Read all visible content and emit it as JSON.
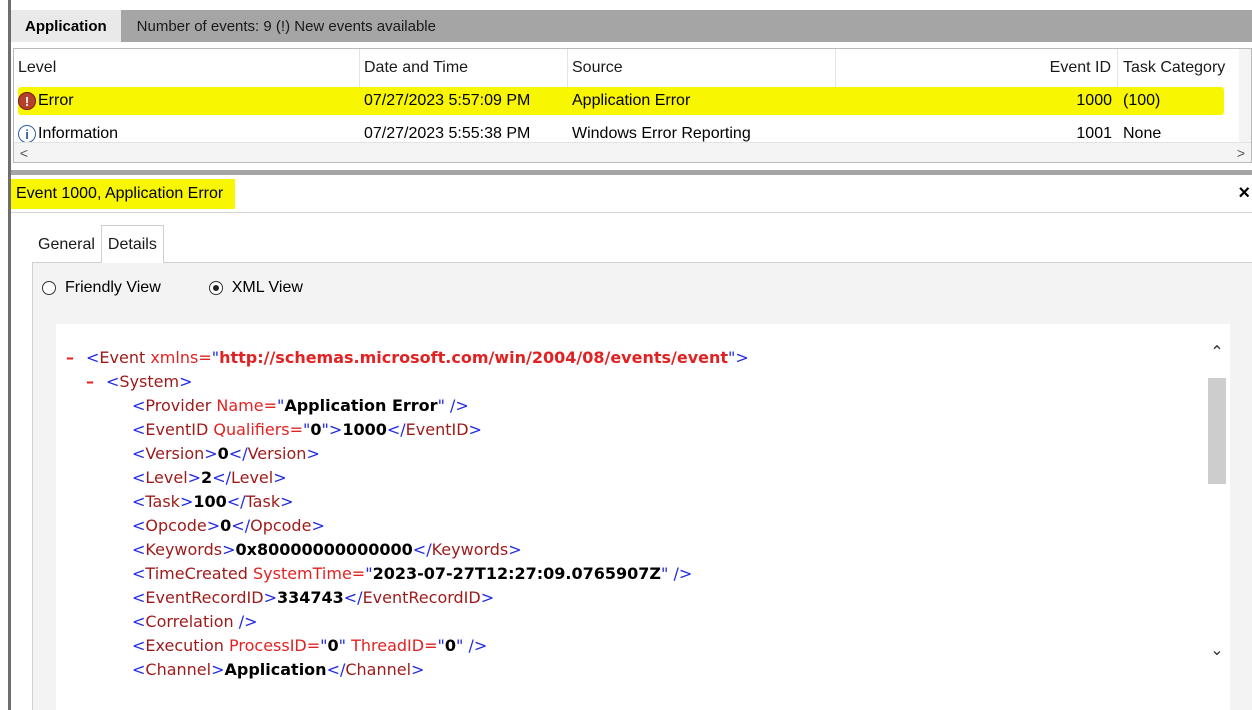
{
  "header": {
    "tab_label": "Application",
    "info": "Number of events: 9 (!) New events available"
  },
  "grid": {
    "columns": [
      "Level",
      "Date and Time",
      "Source",
      "Event ID",
      "Task Category"
    ],
    "rows": [
      {
        "level": "Error",
        "date": "07/27/2023 5:57:09 PM",
        "source": "Application Error",
        "event_id": "1000",
        "task": "(100)",
        "icon": "error-icon"
      },
      {
        "level": "Information",
        "date": "07/27/2023 5:55:38 PM",
        "source": "Windows Error Reporting",
        "event_id": "1001",
        "task": "None",
        "icon": "info-icon"
      }
    ],
    "scroll_left": "<",
    "scroll_right": ">"
  },
  "details": {
    "title": "Event 1000, Application Error",
    "close": "×",
    "tabs": [
      "General",
      "Details"
    ],
    "active_tab": "Details",
    "view_options": [
      "Friendly View",
      "XML View"
    ],
    "selected_view": "XML View"
  },
  "xml": {
    "lines": [
      {
        "indent": 0,
        "dash": "–",
        "parts": [
          [
            "b",
            "<"
          ],
          [
            "t",
            "Event"
          ],
          [
            "a",
            " xmlns="
          ],
          [
            "b",
            "\""
          ],
          [
            "u",
            "http://schemas.microsoft.com/win/2004/08/events/event"
          ],
          [
            "b",
            "\">"
          ]
        ]
      },
      {
        "indent": 1,
        "dash": "–",
        "parts": [
          [
            "b",
            "<"
          ],
          [
            "t",
            "System"
          ],
          [
            "b",
            ">"
          ]
        ]
      },
      {
        "indent": 2,
        "dash": "",
        "parts": [
          [
            "b",
            "<"
          ],
          [
            "t",
            "Provider"
          ],
          [
            "a",
            " Name="
          ],
          [
            "b",
            "\""
          ],
          [
            "v",
            "Application Error"
          ],
          [
            "b",
            "\" />"
          ]
        ]
      },
      {
        "indent": 2,
        "dash": "",
        "parts": [
          [
            "b",
            "<"
          ],
          [
            "t",
            "EventID"
          ],
          [
            "a",
            " Qualifiers="
          ],
          [
            "b",
            "\""
          ],
          [
            "v",
            "0"
          ],
          [
            "b",
            "\">"
          ],
          [
            "v",
            "1000"
          ],
          [
            "b",
            "</"
          ],
          [
            "t",
            "EventID"
          ],
          [
            "b",
            ">"
          ]
        ]
      },
      {
        "indent": 2,
        "dash": "",
        "parts": [
          [
            "b",
            "<"
          ],
          [
            "t",
            "Version"
          ],
          [
            "b",
            ">"
          ],
          [
            "v",
            "0"
          ],
          [
            "b",
            "</"
          ],
          [
            "t",
            "Version"
          ],
          [
            "b",
            ">"
          ]
        ]
      },
      {
        "indent": 2,
        "dash": "",
        "parts": [
          [
            "b",
            "<"
          ],
          [
            "t",
            "Level"
          ],
          [
            "b",
            ">"
          ],
          [
            "v",
            "2"
          ],
          [
            "b",
            "</"
          ],
          [
            "t",
            "Level"
          ],
          [
            "b",
            ">"
          ]
        ]
      },
      {
        "indent": 2,
        "dash": "",
        "parts": [
          [
            "b",
            "<"
          ],
          [
            "t",
            "Task"
          ],
          [
            "b",
            ">"
          ],
          [
            "v",
            "100"
          ],
          [
            "b",
            "</"
          ],
          [
            "t",
            "Task"
          ],
          [
            "b",
            ">"
          ]
        ]
      },
      {
        "indent": 2,
        "dash": "",
        "parts": [
          [
            "b",
            "<"
          ],
          [
            "t",
            "Opcode"
          ],
          [
            "b",
            ">"
          ],
          [
            "v",
            "0"
          ],
          [
            "b",
            "</"
          ],
          [
            "t",
            "Opcode"
          ],
          [
            "b",
            ">"
          ]
        ]
      },
      {
        "indent": 2,
        "dash": "",
        "parts": [
          [
            "b",
            "<"
          ],
          [
            "t",
            "Keywords"
          ],
          [
            "b",
            ">"
          ],
          [
            "v",
            "0x80000000000000"
          ],
          [
            "b",
            "</"
          ],
          [
            "t",
            "Keywords"
          ],
          [
            "b",
            ">"
          ]
        ]
      },
      {
        "indent": 2,
        "dash": "",
        "parts": [
          [
            "b",
            "<"
          ],
          [
            "t",
            "TimeCreated"
          ],
          [
            "a",
            " SystemTime="
          ],
          [
            "b",
            "\""
          ],
          [
            "v",
            "2023-07-27T12:27:09.0765907Z"
          ],
          [
            "b",
            "\" />"
          ]
        ]
      },
      {
        "indent": 2,
        "dash": "",
        "parts": [
          [
            "b",
            "<"
          ],
          [
            "t",
            "EventRecordID"
          ],
          [
            "b",
            ">"
          ],
          [
            "v",
            "334743"
          ],
          [
            "b",
            "</"
          ],
          [
            "t",
            "EventRecordID"
          ],
          [
            "b",
            ">"
          ]
        ]
      },
      {
        "indent": 2,
        "dash": "",
        "parts": [
          [
            "b",
            "<"
          ],
          [
            "t",
            "Correlation"
          ],
          [
            "b",
            " />"
          ]
        ]
      },
      {
        "indent": 2,
        "dash": "",
        "parts": [
          [
            "b",
            "<"
          ],
          [
            "t",
            "Execution"
          ],
          [
            "a",
            " ProcessID="
          ],
          [
            "b",
            "\""
          ],
          [
            "v",
            "0"
          ],
          [
            "b",
            "\""
          ],
          [
            "a",
            " ThreadID="
          ],
          [
            "b",
            "\""
          ],
          [
            "v",
            "0"
          ],
          [
            "b",
            "\" />"
          ]
        ]
      },
      {
        "indent": 2,
        "dash": "",
        "parts": [
          [
            "b",
            "<"
          ],
          [
            "t",
            "Channel"
          ],
          [
            "b",
            ">"
          ],
          [
            "v",
            "Application"
          ],
          [
            "b",
            "</"
          ],
          [
            "t",
            "Channel"
          ],
          [
            "b",
            ">"
          ]
        ]
      }
    ]
  },
  "colors": {
    "highlight": "#f8f600",
    "xml_bracket": "#1f28e6",
    "xml_tag": "#9e1a1a",
    "xml_attr": "#e22222",
    "xml_value": "#000000"
  }
}
